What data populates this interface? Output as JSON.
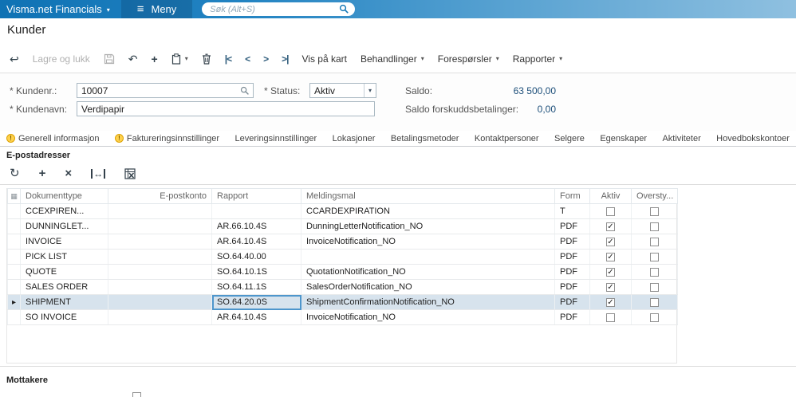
{
  "colors": {
    "brand_blue": "#1176b5",
    "selected_row": "#d7e3ed",
    "highlight_yellow": "#e3ec55",
    "warning_yellow": "#ffd24d"
  },
  "icons": {
    "brand_caret": "▾",
    "menu": "≡",
    "back": "↩",
    "undo": "↶",
    "add": "+",
    "clipboard_caret": "▾",
    "nav_first": "|<",
    "nav_prev": "<",
    "nav_next": ">",
    "nav_last": ">|",
    "menu_caret": "▾",
    "refresh": "↻",
    "grid_add": "+",
    "grid_delete": "×",
    "fit_width": "↔",
    "header_grid": "▦",
    "row_arrow": "▸",
    "check": "✓",
    "warning": "!"
  },
  "topbar": {
    "brand": "Visma.net Financials",
    "menu_label": "Meny",
    "search_placeholder": "Søk (Alt+S)"
  },
  "page": {
    "title": "Kunder"
  },
  "toolbar": {
    "save_and_close": "Lagre og lukk",
    "view_on_map": "Vis på kart",
    "behandlinger": "Behandlinger",
    "foresporsler": "Forespørsler",
    "rapporter": "Rapporter"
  },
  "form": {
    "kundenr_label": "* Kundenr.:",
    "kundenr_value": "10007",
    "kundenavn_label": "* Kundenavn:",
    "kundenavn_value": "Verdipapir",
    "status_label": "* Status:",
    "status_value": "Aktiv",
    "saldo_label": "Saldo:",
    "saldo_value": "63 500,00",
    "saldo_forskudd_label": "Saldo forskuddsbetalinger:",
    "saldo_forskudd_value": "0,00"
  },
  "tabs": [
    {
      "label": "Generell informasjon",
      "warning": true
    },
    {
      "label": "Faktureringsinnstillinger",
      "warning": true
    },
    {
      "label": "Leveringsinnstillinger",
      "warning": false
    },
    {
      "label": "Lokasjoner",
      "warning": false
    },
    {
      "label": "Betalingsmetoder",
      "warning": false
    },
    {
      "label": "Kontaktpersoner",
      "warning": false
    },
    {
      "label": "Selgere",
      "warning": false
    },
    {
      "label": "Egenskaper",
      "warning": false
    },
    {
      "label": "Aktiviteter",
      "warning": false
    },
    {
      "label": "Hovedbokskontoer",
      "warning": false
    }
  ],
  "section": {
    "title": "E-postadresser"
  },
  "grid": {
    "columns": [
      "Dokumenttype",
      "E-postkonto",
      "Rapport",
      "Meldingsmal",
      "Form",
      "Aktiv",
      "Oversty..."
    ],
    "rows": [
      {
        "dokumenttype": "CCEXPIREN...",
        "epostkonto": "",
        "rapport": "",
        "meldingsmal": "CCARDEXPIRATION",
        "form": "T",
        "aktiv": false,
        "overstyr": false,
        "selected": false,
        "rapport_highlight": false
      },
      {
        "dokumenttype": "DUNNINGLET...",
        "epostkonto": "",
        "rapport": "AR.66.10.4S",
        "meldingsmal": "DunningLetterNotification_NO",
        "form": "PDF",
        "aktiv": true,
        "overstyr": false,
        "selected": false,
        "rapport_highlight": false
      },
      {
        "dokumenttype": "INVOICE",
        "epostkonto": "",
        "rapport": "AR.64.10.4S",
        "meldingsmal": "InvoiceNotification_NO",
        "form": "PDF",
        "aktiv": true,
        "overstyr": false,
        "selected": false,
        "rapport_highlight": false
      },
      {
        "dokumenttype": "PICK LIST",
        "epostkonto": "",
        "rapport": "SO.64.40.00",
        "meldingsmal": "",
        "form": "PDF",
        "aktiv": true,
        "overstyr": false,
        "selected": false,
        "rapport_highlight": false
      },
      {
        "dokumenttype": "QUOTE",
        "epostkonto": "",
        "rapport": "SO.64.10.1S",
        "meldingsmal": "QuotationNotification_NO",
        "form": "PDF",
        "aktiv": true,
        "overstyr": false,
        "selected": false,
        "rapport_highlight": false
      },
      {
        "dokumenttype": "SALES ORDER",
        "epostkonto": "",
        "rapport": "SO.64.11.1S",
        "meldingsmal": "SalesOrderNotification_NO",
        "form": "PDF",
        "aktiv": true,
        "overstyr": false,
        "selected": false,
        "rapport_highlight": false
      },
      {
        "dokumenttype": "SHIPMENT",
        "epostkonto": "",
        "rapport": "SO.64.20.0S",
        "meldingsmal": "ShipmentConfirmationNotification_NO",
        "form": "PDF",
        "aktiv": true,
        "overstyr": false,
        "selected": true,
        "rapport_highlight": true
      },
      {
        "dokumenttype": "SO INVOICE",
        "epostkonto": "",
        "rapport": "AR.64.10.4S",
        "meldingsmal": "InvoiceNotification_NO",
        "form": "PDF",
        "aktiv": false,
        "overstyr": false,
        "selected": false,
        "rapport_highlight": false
      }
    ]
  },
  "bottom": {
    "mottakere_title": "Mottakere"
  }
}
